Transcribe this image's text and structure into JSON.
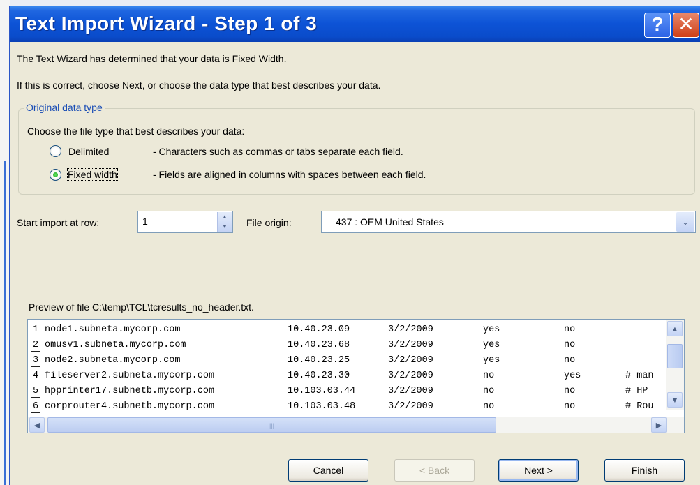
{
  "dialog": {
    "title": "Text Import Wizard - Step 1 of 3",
    "help_button": "?",
    "close_button": "✕"
  },
  "intro": {
    "line1": "The Text Wizard has determined that your data is Fixed Width.",
    "line2": "If this is correct, choose Next, or choose the data type that best describes your data."
  },
  "original_data_type": {
    "group_label": "Original data type",
    "prompt": "Choose the file type that best describes your data:",
    "options": [
      {
        "label": "Delimited",
        "description": "- Characters such as commas or tabs separate each field.",
        "selected": false
      },
      {
        "label": "Fixed width",
        "description": "- Fields are aligned in columns with spaces between each field.",
        "selected": true
      }
    ]
  },
  "start_row": {
    "label": "Start import at row:",
    "value": "1"
  },
  "file_origin": {
    "label": "File origin:",
    "value": "437 : OEM United States"
  },
  "preview": {
    "label": "Preview of file C:\\temp\\TCL\\tcresults_no_header.txt.",
    "rows": [
      {
        "n": "1",
        "c": [
          "node1.subneta.mycorp.com",
          "10.40.23.09",
          "3/2/2009",
          "yes",
          "no",
          ""
        ]
      },
      {
        "n": "2",
        "c": [
          "omusv1.subneta.mycorp.com",
          "10.40.23.68",
          "3/2/2009",
          "yes",
          "no",
          ""
        ]
      },
      {
        "n": "3",
        "c": [
          "node2.subneta.mycorp.com",
          "10.40.23.25",
          "3/2/2009",
          "yes",
          "no",
          ""
        ]
      },
      {
        "n": "4",
        "c": [
          "fileserver2.subneta.mycorp.com",
          "10.40.23.30",
          "3/2/2009",
          "no",
          "yes",
          "# man"
        ]
      },
      {
        "n": "5",
        "c": [
          "hpprinter17.subnetb.mycorp.com",
          "10.103.03.44",
          "3/2/2009",
          "no",
          "no",
          "# HP"
        ]
      },
      {
        "n": "6",
        "c": [
          "corprouter4.subnetb.mycorp.com",
          "10.103.03.48",
          "3/2/2009",
          "no",
          "no",
          "# Rou"
        ]
      }
    ]
  },
  "buttons": {
    "cancel": "Cancel",
    "back": "< Back",
    "next": "Next >",
    "finish": "Finish"
  },
  "colors": {
    "title_bar": "#0a4ccb",
    "dialog_bg": "#ece9d8",
    "group_label": "#1a4db5"
  },
  "icons": {
    "spin_up": "▲",
    "spin_down": "▼",
    "combo": "⌄",
    "scroll_up": "▲",
    "scroll_down": "▼",
    "scroll_left": "◀",
    "scroll_right": "▶",
    "grip": "|||"
  }
}
